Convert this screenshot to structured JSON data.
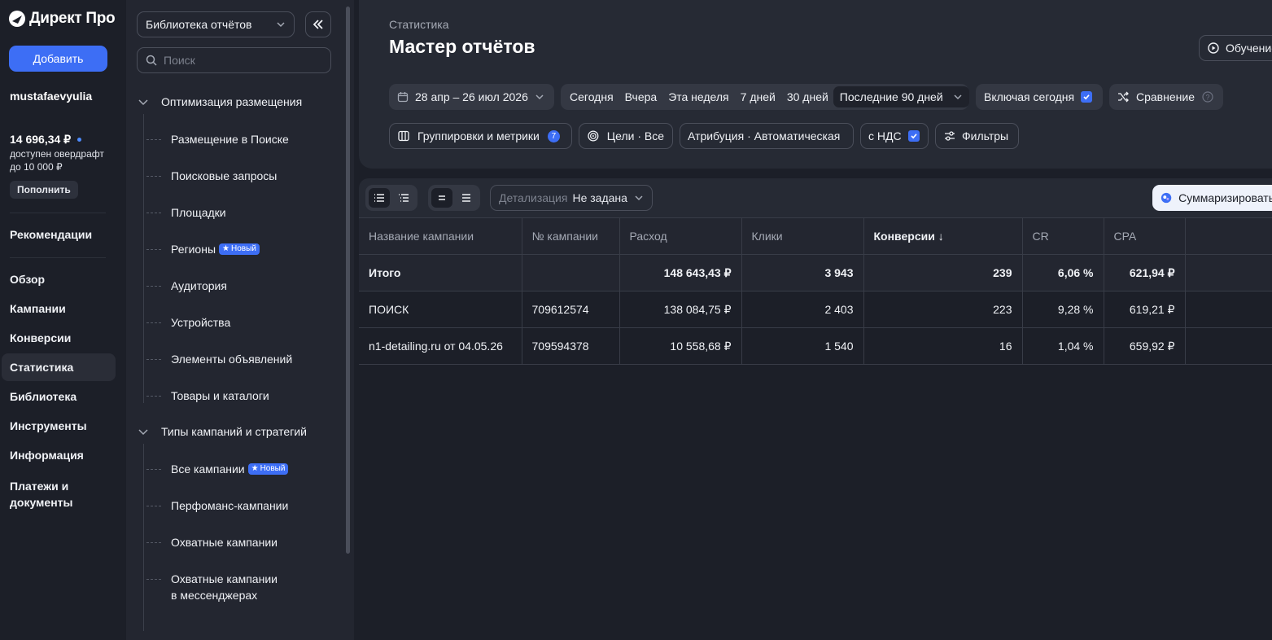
{
  "app": {
    "logo_text": "Директ Про"
  },
  "leftnav": {
    "add_label": "Добавить",
    "username": "mustafaevyulia",
    "balance": "14 696,34 ₽",
    "overdraft_line1": "доступен овердрафт",
    "overdraft_line2": "до 10 000 ₽",
    "topup_label": "Пополнить",
    "recommendations": "Рекомендации",
    "items": [
      "Обзор",
      "Кампании",
      "Конверсии",
      "Статистика",
      "Библиотека",
      "Инструменты",
      "Информация"
    ],
    "payments_line1": "Платежи и",
    "payments_line2": "документы",
    "active_item": "Статистика"
  },
  "library": {
    "select_value": "Библиотека отчётов",
    "search_placeholder": "Поиск",
    "group1_title": "Оптимизация размещения",
    "group1_items": [
      "Размещение в Поиске",
      "Поисковые запросы",
      "Площадки",
      "Регионы",
      "Аудитория",
      "Устройства",
      "Элементы объявлений",
      "Товары и каталоги"
    ],
    "group2_title": "Типы кампаний и стратегий",
    "group2_items": [
      "Все кампании",
      "Перфоманс-кампании",
      "Охватные кампании"
    ],
    "group2_last_line1": "Охватные кампании",
    "group2_last_line2": "в мессенджерах",
    "badge_new": "Новый"
  },
  "header": {
    "breadcrumb": "Статистика",
    "title": "Мастер отчётов",
    "learn_label": "Обучение"
  },
  "filters": {
    "date_range": "28 апр – 26 июл 2026",
    "quick_periods": [
      "Сегодня",
      "Вчера",
      "Эта неделя",
      "7 дней",
      "30 дней"
    ],
    "selected_period": "Последние 90 дней",
    "include_today": "Включая сегодня",
    "comparison": "Сравнение",
    "groupings": "Группировки и метрики",
    "groupings_count": "7",
    "goals": "Цели · Все",
    "attribution": "Атрибуция · Автоматическая",
    "vat": "с НДС",
    "filters_label": "Фильтры"
  },
  "toolbar": {
    "detail_label": "Детализация",
    "detail_value": "Не задана",
    "summarize_label": "Суммаризировать"
  },
  "table": {
    "columns": [
      "Название кампании",
      "№ кампании",
      "Расход",
      "Клики",
      "Конверсии ↓",
      "CR",
      "CPA"
    ],
    "total": {
      "name": "Итого",
      "id": "",
      "spend": "148 643,43 ₽",
      "clicks": "3 943",
      "conversions": "239",
      "cr": "6,06 %",
      "cpa": "621,94 ₽"
    },
    "rows": [
      {
        "name": "ПОИСК",
        "id": "709612574",
        "spend": "138 084,75 ₽",
        "clicks": "2 403",
        "conversions": "223",
        "cr": "9,28 %",
        "cpa": "619,21 ₽"
      },
      {
        "name": "n1-detailing.ru от 04.05.26",
        "id": "709594378",
        "spend": "10 558,68 ₽",
        "clicks": "1 540",
        "conversions": "16",
        "cr": "1,04 %",
        "cpa": "659,92 ₽"
      }
    ]
  },
  "colors": {
    "accent": "#3d6ef5",
    "background": "#1c1f28",
    "panel": "#232630"
  }
}
